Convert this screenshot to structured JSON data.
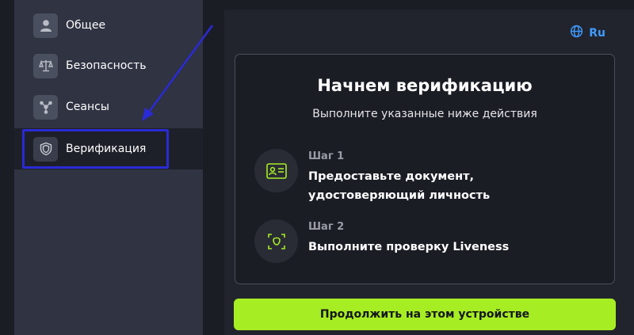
{
  "sidebar": {
    "items": [
      {
        "label": "Общее",
        "icon": "user-icon"
      },
      {
        "label": "Безопасность",
        "icon": "scales-icon"
      },
      {
        "label": "Сеансы",
        "icon": "network-icon"
      },
      {
        "label": "Верификация",
        "icon": "shield-icon"
      }
    ],
    "active_index": 3
  },
  "language": {
    "label": "Ru",
    "icon": "globe-icon"
  },
  "card": {
    "title": "Начнем верификацию",
    "subtitle": "Выполните указанные ниже действия",
    "steps": [
      {
        "number": "Шаг 1",
        "text": "Предоставьте документ, удостоверяющий личность",
        "icon": "id-card-icon"
      },
      {
        "number": "Шаг 2",
        "text": "Выполните проверку Liveness",
        "icon": "face-scan-icon"
      }
    ]
  },
  "cta": {
    "label": "Продолжить на этом устройстве"
  },
  "colors": {
    "accent": "#a7ed24",
    "link": "#3f9bff",
    "annotation": "#2a2ad6"
  }
}
